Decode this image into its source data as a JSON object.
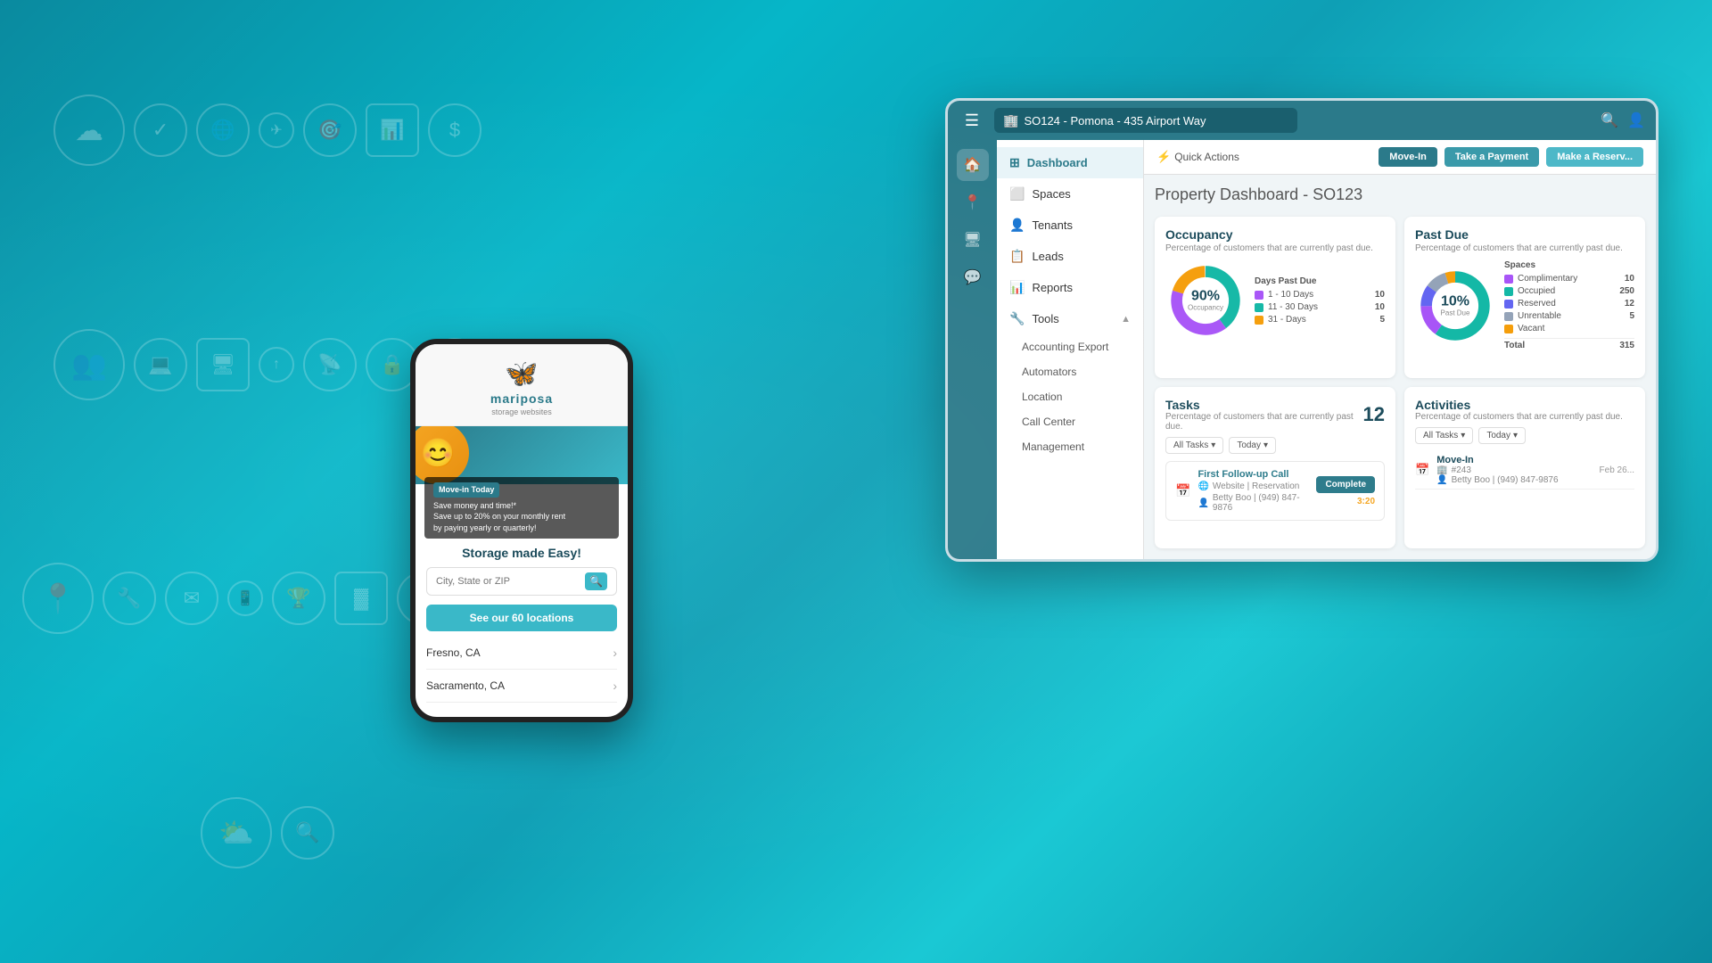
{
  "background": {
    "gradient_start": "#0a8a9f",
    "gradient_end": "#1ac8d4"
  },
  "browser": {
    "url_text": "SO124 - Pomona - 435 Airport Way",
    "hamburger_icon": "☰",
    "search_icon": "🔍",
    "user_icon": "👤"
  },
  "sidebar_icons": [
    "🏠",
    "📍",
    "🖥",
    "💬"
  ],
  "nav": {
    "items": [
      {
        "label": "Dashboard",
        "icon": "⊞",
        "active": true
      },
      {
        "label": "Spaces",
        "icon": "⬜"
      },
      {
        "label": "Tenants",
        "icon": "👤"
      },
      {
        "label": "Leads",
        "icon": "📋"
      },
      {
        "label": "Reports",
        "icon": "📊"
      },
      {
        "label": "Tools",
        "icon": "🔧",
        "expandable": true
      }
    ],
    "sub_items": [
      "Accounting Export",
      "Automators",
      "Location",
      "Call Center",
      "Management"
    ]
  },
  "quick_actions": {
    "label": "Quick Actions",
    "icon": "⚡",
    "buttons": [
      {
        "label": "Move-In",
        "variant": "teal1"
      },
      {
        "label": "Take a Payment",
        "variant": "teal2"
      },
      {
        "label": "Make a Reserv...",
        "variant": "teal3"
      }
    ]
  },
  "dashboard": {
    "title": "Property Dashboard",
    "subtitle": "- SO123",
    "occupancy_widget": {
      "title": "Occupancy",
      "subtitle": "Percentage of customers that are currently past due.",
      "percentage": "90%",
      "center_label": "Occupancy",
      "chart_title": "Days Past Due",
      "legend": [
        {
          "label": "1 - 10 Days",
          "color": "#a855f7",
          "value": "10"
        },
        {
          "label": "11 - 30 Days",
          "color": "#14b8a6",
          "value": "10"
        },
        {
          "label": "31 - Days",
          "color": "#f59e0b",
          "value": "5"
        }
      ],
      "donut_segments": [
        {
          "color": "#a855f7",
          "pct": 40
        },
        {
          "color": "#14b8a6",
          "pct": 40
        },
        {
          "color": "#f59e0b",
          "pct": 20
        }
      ]
    },
    "past_due_widget": {
      "title": "Past Due",
      "subtitle": "Percentage of customers that are currently past due.",
      "percentage": "10%",
      "center_label": "Past Due",
      "chart_title": "Spaces",
      "legend": [
        {
          "label": "Complimentary",
          "color": "#a855f7",
          "value": "10"
        },
        {
          "label": "Occupied",
          "color": "#14b8a6",
          "value": "250"
        },
        {
          "label": "Reserved",
          "color": "#6366f1",
          "value": "12"
        },
        {
          "label": "Unrentable",
          "color": "#94a3b8",
          "value": "5"
        },
        {
          "label": "Vacant",
          "color": "#f59e0b",
          "value": ""
        },
        {
          "label": "Total",
          "color": "",
          "value": "315"
        }
      ],
      "donut_segments": [
        {
          "color": "#a855f7",
          "pct": 15
        },
        {
          "color": "#14b8a6",
          "pct": 60
        },
        {
          "color": "#6366f1",
          "pct": 10
        },
        {
          "color": "#94a3b8",
          "pct": 10
        },
        {
          "color": "#f59e0b",
          "pct": 5
        }
      ]
    },
    "tasks_widget": {
      "title": "Tasks",
      "subtitle": "Percentage of customers that are currently past due.",
      "count": "12",
      "filter_tasks": "All Tasks",
      "filter_time": "Today",
      "task": {
        "name": "First Follow-up Call",
        "source": "Website | Reservation",
        "person": "Betty Boo | (949) 847-9876",
        "time": "3:20",
        "complete_btn": "Complete"
      }
    },
    "activities_widget": {
      "title": "Activities",
      "subtitle": "Percentage of customers that are currently past due.",
      "filter_tasks": "All Tasks",
      "filter_time": "Today",
      "activity": {
        "name": "Move-In",
        "unit": "#243",
        "person": "Betty Boo | (949) 847-9876",
        "date": "Feb 26..."
      }
    }
  },
  "mobile": {
    "logo_icon": "🦋",
    "logo_text": "mariposa",
    "logo_sub": "storage websites",
    "promo_badge": "Move-in Today",
    "promo_line1": "Save money and time!*",
    "promo_line2": "Save up to 20% on your monthly rent",
    "promo_line3": "by paying yearly or quarterly!",
    "tagline": "Storage made Easy!",
    "search_placeholder": "City, State or ZIP",
    "cta": "See our 60 locations",
    "locations": [
      "Fresno, CA",
      "Sacramento, CA"
    ]
  }
}
